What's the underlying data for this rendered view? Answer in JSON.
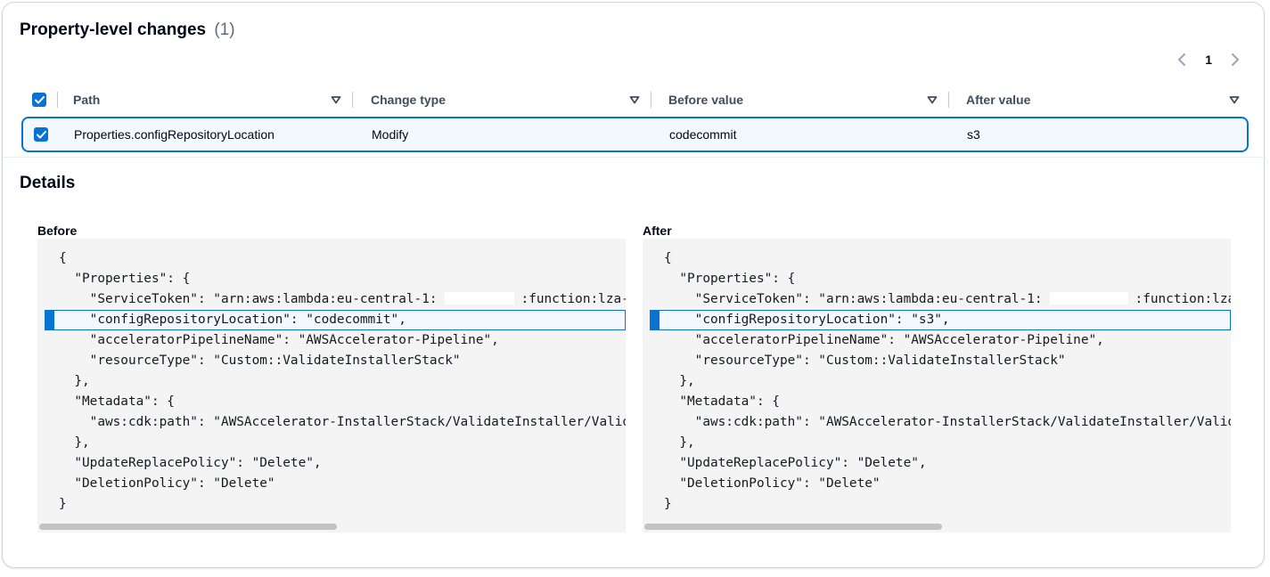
{
  "header": {
    "title": "Property-level changes",
    "count": "(1)"
  },
  "pagination": {
    "current_page": "1",
    "prev_icon": "chevron-left-icon",
    "next_icon": "chevron-right-icon"
  },
  "table": {
    "columns": [
      {
        "label": "Path"
      },
      {
        "label": "Change type"
      },
      {
        "label": "Before value"
      },
      {
        "label": "After value"
      }
    ],
    "rows": [
      {
        "path": "Properties.configRepositoryLocation",
        "change_type": "Modify",
        "before_value": "codecommit",
        "after_value": "s3",
        "selected": true
      }
    ]
  },
  "details": {
    "title": "Details",
    "before": {
      "label": "Before",
      "lines": [
        "{",
        "  \"Properties\": {",
        "    \"ServiceToken\": \"arn:aws:lambda:eu-central-1:",
        "    \"configRepositoryLocation\": \"codecommit\",",
        "    \"acceleratorPipelineName\": \"AWSAccelerator-Pipeline\",",
        "    \"resourceType\": \"Custom::ValidateInstallerStack\"",
        "  },",
        "  \"Metadata\": {",
        "    \"aws:cdk:path\": \"AWSAccelerator-InstallerStack/ValidateInstaller/Validat",
        "  },",
        "  \"UpdateReplacePolicy\": \"Delete\",",
        "  \"DeletionPolicy\": \"Delete\"",
        "}"
      ],
      "service_token_suffix": ":function:lza-V"
    },
    "after": {
      "label": "After",
      "lines": [
        "{",
        "  \"Properties\": {",
        "    \"ServiceToken\": \"arn:aws:lambda:eu-central-1:",
        "    \"configRepositoryLocation\": \"s3\",",
        "    \"acceleratorPipelineName\": \"AWSAccelerator-Pipeline\",",
        "    \"resourceType\": \"Custom::ValidateInstallerStack\"",
        "  },",
        "  \"Metadata\": {",
        "    \"aws:cdk:path\": \"AWSAccelerator-InstallerStack/ValidateInstaller/Validat",
        "  },",
        "  \"UpdateReplacePolicy\": \"Delete\",",
        "  \"DeletionPolicy\": \"Delete\"",
        "}"
      ],
      "service_token_suffix": ":function:lza-V"
    }
  },
  "colors": {
    "accent": "#0972d3",
    "code_background": "#f4f4f4",
    "highlight_background": "#f2f8fd"
  }
}
